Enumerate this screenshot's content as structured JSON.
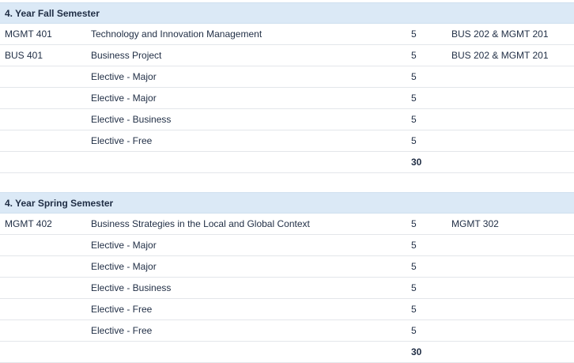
{
  "semesters": [
    {
      "title": "4. Year Fall Semester",
      "courses": [
        {
          "code": "MGMT 401",
          "title": "Technology and Innovation Management",
          "credits": "5",
          "prereq": "BUS 202 & MGMT 201"
        },
        {
          "code": "BUS 401",
          "title": "Business Project",
          "credits": "5",
          "prereq": "BUS 202 & MGMT 201"
        },
        {
          "code": "",
          "title": "Elective - Major",
          "credits": "5",
          "prereq": ""
        },
        {
          "code": "",
          "title": "Elective - Major",
          "credits": "5",
          "prereq": ""
        },
        {
          "code": "",
          "title": "Elective - Business",
          "credits": "5",
          "prereq": ""
        },
        {
          "code": "",
          "title": "Elective - Free",
          "credits": "5",
          "prereq": ""
        }
      ],
      "total": "30"
    },
    {
      "title": "4. Year Spring Semester",
      "courses": [
        {
          "code": "MGMT 402",
          "title": "Business Strategies in the Local and Global Context",
          "credits": "5",
          "prereq": "MGMT 302"
        },
        {
          "code": "",
          "title": "Elective - Major",
          "credits": "5",
          "prereq": ""
        },
        {
          "code": "",
          "title": "Elective - Major",
          "credits": "5",
          "prereq": ""
        },
        {
          "code": "",
          "title": "Elective - Business",
          "credits": "5",
          "prereq": ""
        },
        {
          "code": "",
          "title": "Elective - Free",
          "credits": "5",
          "prereq": ""
        },
        {
          "code": "",
          "title": "Elective - Free",
          "credits": "5",
          "prereq": ""
        }
      ],
      "total": "30"
    }
  ]
}
